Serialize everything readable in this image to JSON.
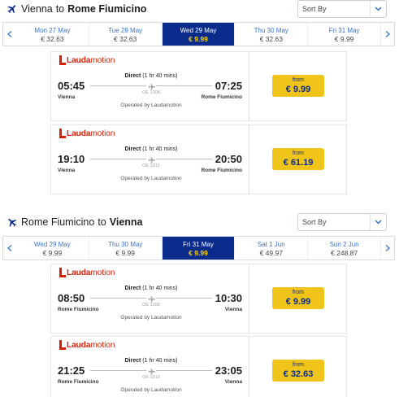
{
  "outbound": {
    "title_from": "Vienna",
    "title_to_word": "to",
    "title_to": "Rome Fiumicino",
    "sort_label": "Sort By",
    "dates": [
      {
        "label": "Mon 27 May",
        "price": "€ 32.63",
        "active": false
      },
      {
        "label": "Tue 28 May",
        "price": "€ 32.63",
        "active": false
      },
      {
        "label": "Wed 29 May",
        "price": "€ 9.99",
        "active": true
      },
      {
        "label": "Thu 30 May",
        "price": "€ 32.63",
        "active": false
      },
      {
        "label": "Fri 31 May",
        "price": "€ 9.99",
        "active": false
      }
    ],
    "flights": [
      {
        "airline_a": "Lauda",
        "airline_b": "motion",
        "dep_time": "05:45",
        "arr_time": "07:25",
        "dep_city": "Vienna",
        "arr_city": "Rome Fiumicino",
        "direct": "Direct",
        "duration": "(1 hr 40 mins)",
        "code": "OE 1308",
        "operated": "Operated by Laudamotion",
        "from": "from",
        "price": "€ 9.99"
      },
      {
        "airline_a": "Lauda",
        "airline_b": "motion",
        "dep_time": "19:10",
        "arr_time": "20:50",
        "dep_city": "Vienna",
        "arr_city": "Rome Fiumicino",
        "direct": "Direct",
        "duration": "(1 hr 40 mins)",
        "code": "OE 1312",
        "operated": "Operated by Laudamotion",
        "from": "from",
        "price": "€ 61.19"
      }
    ]
  },
  "inbound": {
    "title_from": "Rome Fiumicino",
    "title_to_word": "to",
    "title_to": "Vienna",
    "sort_label": "Sort By",
    "dates": [
      {
        "label": "Wed 29 May",
        "price": "€ 9.99",
        "active": false
      },
      {
        "label": "Thu 30 May",
        "price": "€ 9.99",
        "active": false
      },
      {
        "label": "Fri 31 May",
        "price": "€ 9.99",
        "active": true
      },
      {
        "label": "Sat 1 Jun",
        "price": "€ 49.97",
        "active": false
      },
      {
        "label": "Sun 2 Jun",
        "price": "€ 248.87",
        "active": false
      }
    ],
    "flights": [
      {
        "airline_a": "Lauda",
        "airline_b": "motion",
        "dep_time": "08:50",
        "arr_time": "10:30",
        "dep_city": "Rome Fiumicino",
        "arr_city": "Vienna",
        "direct": "Direct",
        "duration": "(1 hr 40 mins)",
        "code": "OE 1309",
        "operated": "Operated by Laudamotion",
        "from": "from",
        "price": "€ 9.99"
      },
      {
        "airline_a": "Lauda",
        "airline_b": "motion",
        "dep_time": "21:25",
        "arr_time": "23:05",
        "dep_city": "Rome Fiumicino",
        "arr_city": "Vienna",
        "direct": "Direct",
        "duration": "(1 hr 40 mins)",
        "code": "OE 1313",
        "operated": "Operated by Laudamotion",
        "from": "from",
        "price": "€ 32.63"
      }
    ]
  },
  "colors": {
    "accent": "#0a2b8c",
    "fare": "#f0c419",
    "brand": "#d81e05",
    "link": "#3a74c4"
  }
}
